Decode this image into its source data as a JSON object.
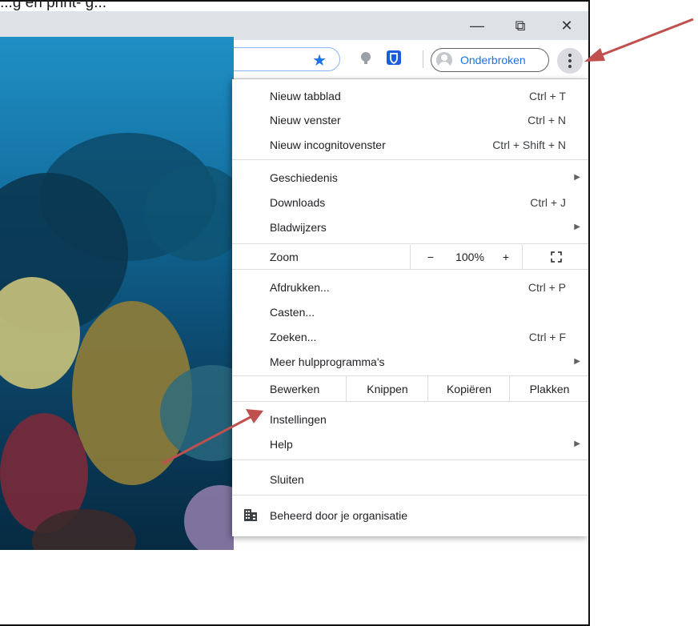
{
  "caption": "...g en print- g...",
  "window_controls": {
    "minimize": "—",
    "restore": "⧉",
    "close": "✕"
  },
  "toolbar": {
    "profile_label": "Onderbroken"
  },
  "menu": {
    "items_top": [
      {
        "label": "Nieuw tabblad",
        "shortcut": "Ctrl + T"
      },
      {
        "label": "Nieuw venster",
        "shortcut": "Ctrl + N"
      },
      {
        "label": "Nieuw incognitovenster",
        "shortcut": "Ctrl + Shift + N"
      }
    ],
    "items_mid": [
      {
        "label": "Geschiedenis",
        "submenu": "▶"
      },
      {
        "label": "Downloads",
        "shortcut": "Ctrl + J"
      },
      {
        "label": "Bladwijzers",
        "submenu": "▶"
      }
    ],
    "zoom": {
      "label": "Zoom",
      "minus": "−",
      "value": "100%",
      "plus": "+"
    },
    "items_tools": [
      {
        "label": "Afdrukken...",
        "shortcut": "Ctrl + P"
      },
      {
        "label": "Casten..."
      },
      {
        "label": "Zoeken...",
        "shortcut": "Ctrl + F"
      },
      {
        "label": "Meer hulpprogramma's",
        "submenu": "▶"
      }
    ],
    "edit": {
      "label": "Bewerken",
      "cut": "Knippen",
      "copy": "Kopiëren",
      "paste": "Plakken"
    },
    "items_settings": [
      {
        "label": "Instellingen"
      },
      {
        "label": "Help",
        "submenu": "▶"
      }
    ],
    "exit": {
      "label": "Sluiten"
    },
    "managed": {
      "label": "Beheerd door je organisatie"
    }
  },
  "colors": {
    "accent": "#1a73e8",
    "annotation_arrow": "#c0504d"
  }
}
